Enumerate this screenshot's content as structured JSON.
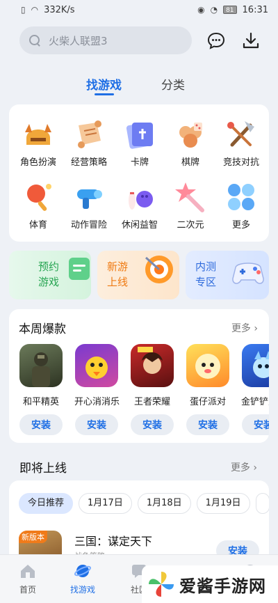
{
  "status_bar": {
    "speed": "332K/s",
    "battery": "81",
    "time": "16:31"
  },
  "search": {
    "placeholder": "火柴人联盟3"
  },
  "tabs": [
    {
      "label": "找游戏",
      "active": true
    },
    {
      "label": "分类",
      "active": false
    }
  ],
  "categories": [
    {
      "label": "角色扮演",
      "icon": "helmet-icon"
    },
    {
      "label": "经营策略",
      "icon": "scroll-icon"
    },
    {
      "label": "卡牌",
      "icon": "cards-icon"
    },
    {
      "label": "棋牌",
      "icon": "poker-icon"
    },
    {
      "label": "竞技对抗",
      "icon": "axe-icon"
    },
    {
      "label": "体育",
      "icon": "pingpong-icon"
    },
    {
      "label": "动作冒险",
      "icon": "gun-icon"
    },
    {
      "label": "休闲益智",
      "icon": "bowling-icon"
    },
    {
      "label": "二次元",
      "icon": "star-wand-icon"
    },
    {
      "label": "更多",
      "icon": "more-apps-icon"
    }
  ],
  "promos": [
    {
      "line1": "预约",
      "line2": "游戏",
      "icon": "calendar-icon"
    },
    {
      "line1": "新游",
      "line2": "上线",
      "icon": "target-icon"
    },
    {
      "line1": "内测",
      "line2": "专区",
      "icon": "gamepad-icon"
    }
  ],
  "hot": {
    "title": "本周爆款",
    "more": "更多",
    "games": [
      {
        "name": "和平精英",
        "install": "安装"
      },
      {
        "name": "开心消消乐",
        "install": "安装"
      },
      {
        "name": "王者荣耀",
        "install": "安装"
      },
      {
        "name": "蛋仔派对",
        "install": "安装"
      },
      {
        "name": "金铲铲之战",
        "install": "安装"
      }
    ]
  },
  "upcoming": {
    "title": "即将上线",
    "more": "更多",
    "chips": [
      "今日推荐",
      "1月17日",
      "1月18日",
      "1月19日"
    ],
    "game": {
      "tag": "新版本",
      "name": "三国：谋定天下",
      "sub": "战争策略",
      "install": "安装"
    }
  },
  "bottom_nav": [
    {
      "label": "首页",
      "active": false
    },
    {
      "label": "找游戏",
      "active": true
    },
    {
      "label": "社区",
      "active": false
    },
    {
      "label": "",
      "active": false
    },
    {
      "label": "",
      "active": false
    }
  ],
  "watermark": {
    "text": "爱酱手游网"
  },
  "colors": {
    "accent": "#1f6fe5",
    "install_bg": "#e9edf3",
    "promo_green": "#27a552",
    "promo_orange": "#ef7a12",
    "promo_blue": "#2f6bdc"
  }
}
